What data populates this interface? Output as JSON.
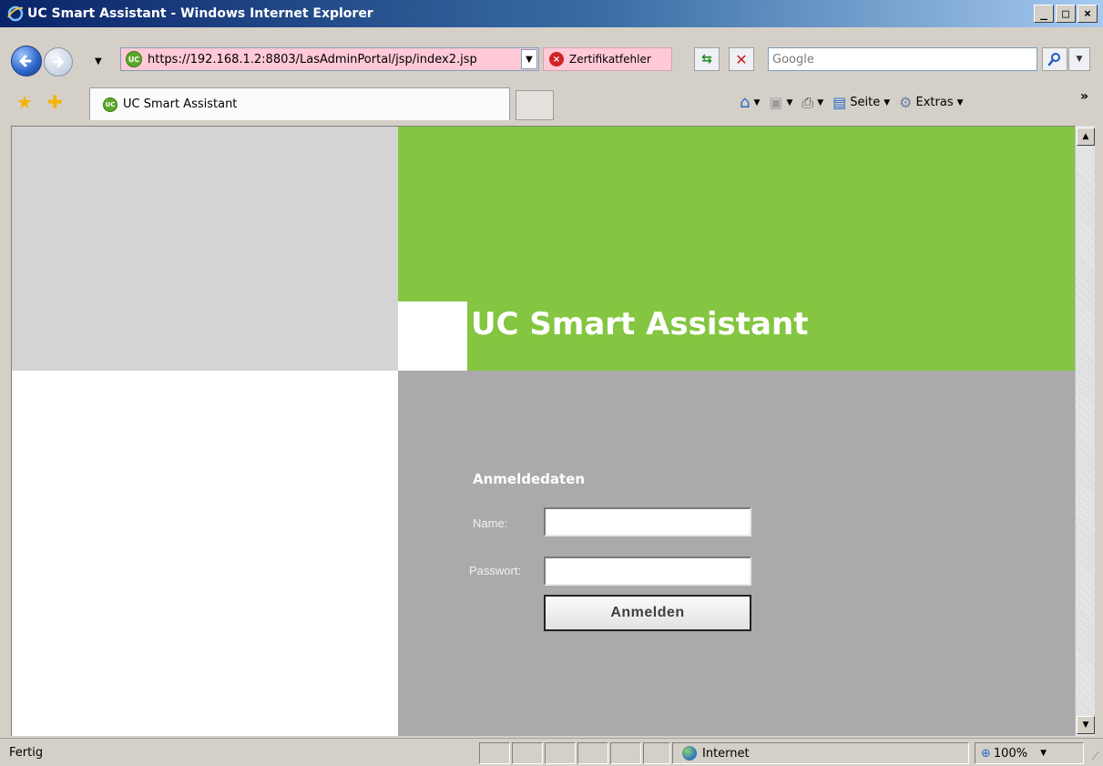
{
  "window": {
    "title": "UC Smart Assistant - Windows Internet Explorer",
    "buttons": [
      "_",
      "□",
      "×"
    ]
  },
  "addressbar": {
    "url": "https://192.168.1.2:8803/LasAdminPortal/jsp/index2.jsp",
    "site_icon_text": "UC",
    "cert_error": "Zertifikatfehler",
    "search_placeholder": "Google"
  },
  "tabs": {
    "active_tab": "UC Smart Assistant",
    "site_icon_text": "UC"
  },
  "commandbar": {
    "page_label": "Seite",
    "tools_label": "Extras"
  },
  "page": {
    "brand_title": "UC Smart Assistant",
    "login_heading": "Anmeldedaten",
    "name_label": "Name:",
    "name_value": "",
    "password_label": "Passwort:",
    "password_value": "",
    "login_button": "Anmelden",
    "colors": {
      "header_green": "#84c541",
      "panel_grey": "#aba9ab",
      "left_grey": "#d4d4d4"
    }
  },
  "statusbar": {
    "status": "Fertig",
    "zone": "Internet",
    "zoom": "100%"
  }
}
